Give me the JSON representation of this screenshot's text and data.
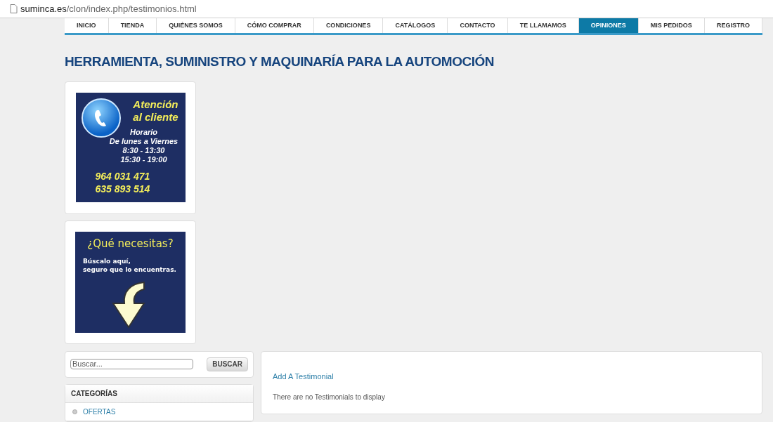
{
  "address_bar": {
    "domain": "suminca.es",
    "path": "/clon/index.php/testimonios.html"
  },
  "nav": [
    {
      "label": "INICIO",
      "selected": false
    },
    {
      "label": "TIENDA",
      "selected": false
    },
    {
      "label": "QUIÉNES SOMOS",
      "selected": false
    },
    {
      "label": "CÓMO COMPRAR",
      "selected": false
    },
    {
      "label": "CONDICIONES",
      "selected": false
    },
    {
      "label": "CATÁLOGOS",
      "selected": false
    },
    {
      "label": "CONTACTO",
      "selected": false
    },
    {
      "label": "TE LLAMAMOS",
      "selected": false
    },
    {
      "label": "OPINIONES",
      "selected": true
    },
    {
      "label": "MIS PEDIDOS",
      "selected": false
    },
    {
      "label": "REGISTRO",
      "selected": false
    }
  ],
  "site_title": "HERRAMIENTA, SUMINISTRO Y MAQUINARÍA PARA LA AUTOMOCIÓN",
  "contact_banner": {
    "heading": [
      "Atención",
      "al cliente"
    ],
    "hours": [
      "Horario",
      "De lunes a Viernes",
      "8:30 - 13:30",
      "15:30 - 19:00"
    ],
    "phones": [
      "964 031 471",
      "635 893 514"
    ]
  },
  "search_banner": {
    "heading": "¿Qué necesitas?",
    "lines": [
      "Búscalo aquí,",
      "seguro que lo encuentras."
    ]
  },
  "search": {
    "placeholder": "Buscar...",
    "button": "BUSCAR"
  },
  "categories": {
    "title": "CATEGORÍAS",
    "items": [
      "OFERTAS"
    ]
  },
  "testimonials": {
    "link": "Add A Testimonial",
    "message": "There are no Testimonials to display"
  }
}
